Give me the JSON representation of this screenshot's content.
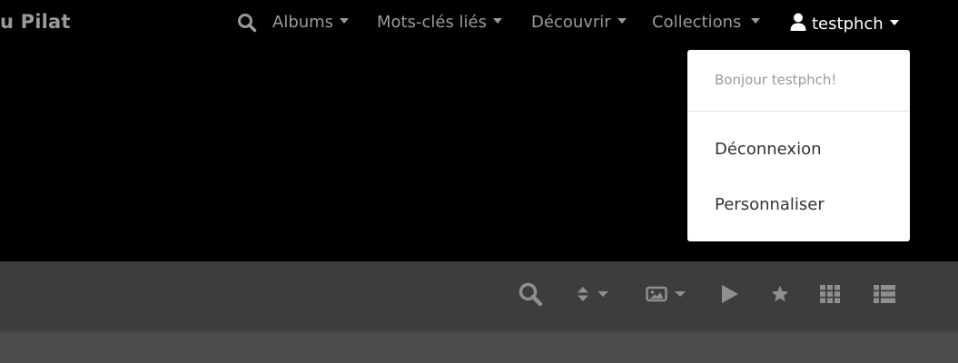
{
  "brand": {
    "title": "u Pilat"
  },
  "nav": {
    "search_icon": "search-icon",
    "items": [
      {
        "label": "Albums"
      },
      {
        "label": "Mots-clés liés"
      },
      {
        "label": "Découvrir"
      },
      {
        "label": "Collections"
      }
    ],
    "user": {
      "icon": "user-icon",
      "label": "testphch"
    }
  },
  "user_menu": {
    "greeting": "Bonjour testphch!",
    "items": [
      {
        "label": "Déconnexion"
      },
      {
        "label": "Personnaliser"
      }
    ]
  },
  "toolbar": {
    "buttons": [
      {
        "icon": "search-icon"
      },
      {
        "icon": "sort-icon"
      },
      {
        "icon": "image-size-icon"
      },
      {
        "icon": "play-slideshow-icon"
      },
      {
        "icon": "star-icon"
      },
      {
        "icon": "grid-view-icon"
      },
      {
        "icon": "list-view-icon"
      }
    ]
  },
  "colors": {
    "background": "#000000",
    "nav_text": "#9a9a9a",
    "active_text": "#ffffff",
    "dropdown_bg": "#ffffff",
    "toolbar_bg": "#3d3d3d",
    "toolbar_icon": "#8f8f8f",
    "content_bg": "#4d4d4d"
  }
}
